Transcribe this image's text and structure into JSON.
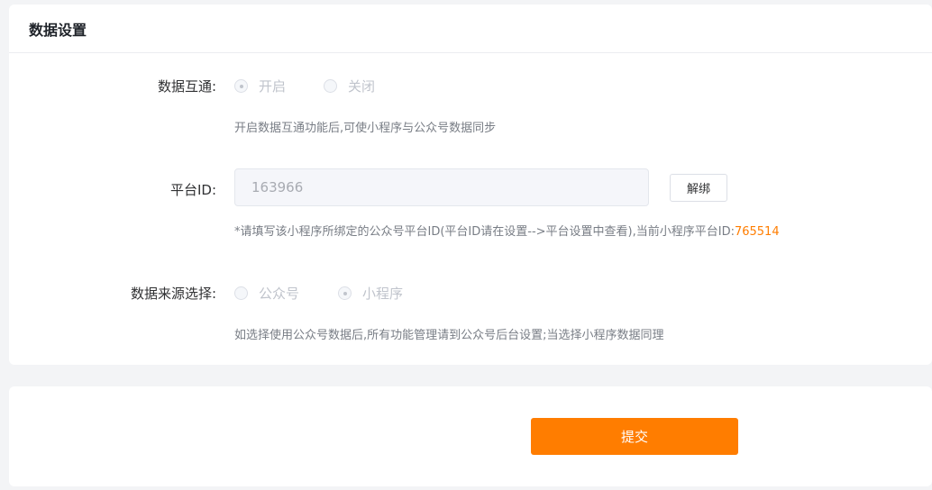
{
  "card": {
    "title": "数据设置"
  },
  "data_sync": {
    "label": "数据互通:",
    "options": [
      "开启",
      "关闭"
    ],
    "selected": "开启",
    "hint": "开启数据互通功能后,可使小程序与公众号数据同步"
  },
  "platform_id": {
    "label": "平台ID:",
    "value": "163966",
    "unbind_label": "解绑",
    "hint_prefix": "*请填写该小程序所绑定的公众号平台ID(平台ID请在设置-->平台设置中查看),当前小程序平台ID:",
    "hint_value": "765514"
  },
  "data_source": {
    "label": "数据来源选择:",
    "options": [
      "公众号",
      "小程序"
    ],
    "selected": "小程序",
    "hint": "如选择使用公众号数据后,所有功能管理请到公众号后台设置;当选择小程序数据同理"
  },
  "footer": {
    "submit_label": "提交"
  },
  "colors": {
    "accent": "#ff7d00"
  }
}
